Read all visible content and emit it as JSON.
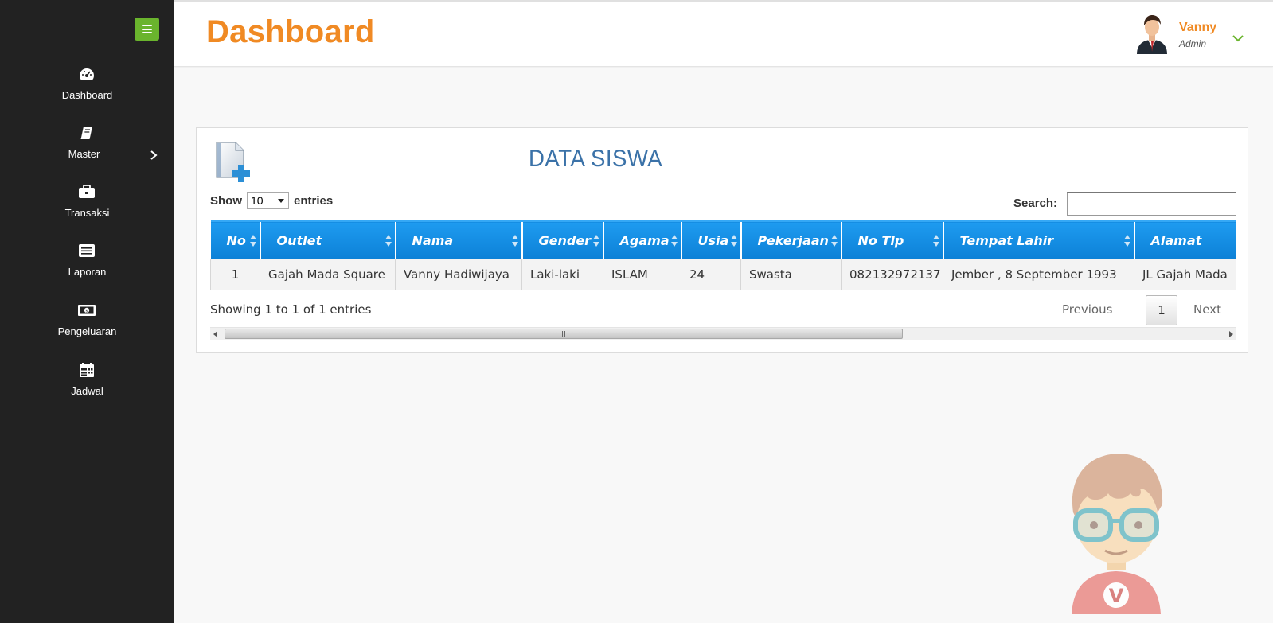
{
  "sidebar": {
    "items": [
      {
        "label": "Dashboard",
        "icon": "dashboard-gauge-icon"
      },
      {
        "label": "Master",
        "icon": "book-icon"
      },
      {
        "label": "Transaksi",
        "icon": "briefcase-icon"
      },
      {
        "label": "Laporan",
        "icon": "list-icon"
      },
      {
        "label": "Pengeluaran",
        "icon": "money-icon"
      },
      {
        "label": "Jadwal",
        "icon": "calendar-icon"
      }
    ]
  },
  "header": {
    "title": "Dashboard",
    "user": {
      "name": "Vanny",
      "role": "Admin"
    }
  },
  "card": {
    "title": "DATA SISWA",
    "length": {
      "show": "Show",
      "value": "10",
      "entries": "entries"
    },
    "search": {
      "label": "Search:",
      "value": ""
    },
    "table": {
      "columns": [
        "No",
        "Outlet",
        "Nama",
        "Gender",
        "Agama",
        "Usia",
        "Pekerjaan",
        "No Tlp",
        "Tempat Lahir",
        "Alamat"
      ],
      "rows": [
        [
          "1",
          "Gajah Mada Square",
          "Vanny Hadiwijaya",
          "Laki-laki",
          "ISLAM",
          "24",
          "Swasta",
          "082132972137",
          "Jember , 8 September 1993",
          "JL Gajah Mada"
        ]
      ]
    },
    "info": "Showing 1 to 1 of 1 entries",
    "pagination": {
      "previous": "Previous",
      "current": "1",
      "next": "Next"
    }
  },
  "colors": {
    "accent_orange": "#f08a24",
    "sidebar_bg": "#222222",
    "toggle_green": "#6ab42d",
    "table_header_blue": "#1e9bf0",
    "title_blue": "#3b72a8"
  }
}
